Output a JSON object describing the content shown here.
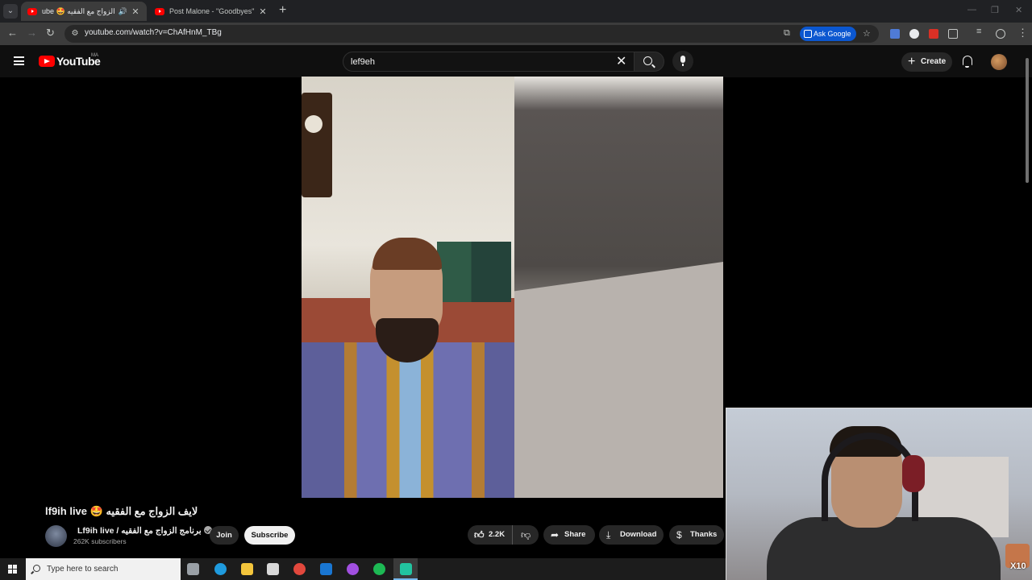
{
  "browser": {
    "tabs": [
      {
        "title": "ube 🤩 لايف الزواج مع الفقيه",
        "active": true
      },
      {
        "title": "Post Malone - \"Goodbyes\" ft. Yo",
        "active": false
      }
    ],
    "url": "youtube.com/watch?v=ChAfHnM_TBg",
    "ask_google": "Ask Google"
  },
  "youtube": {
    "logo_text": "YouTube",
    "country_code": "MA",
    "search_value": "lef9eh",
    "create_label": "Create"
  },
  "video": {
    "title": "lf9ih live 🤩 لايف الزواج مع الفقيه",
    "channel_name": "Lf9ih live / برنامج الزواج مع الفقيه",
    "subscribers": "262K subscribers",
    "join_label": "Join",
    "subscribe_label": "Subscribe",
    "likes": "2.2K",
    "share_label": "Share",
    "download_label": "Download",
    "thanks_label": "Thanks"
  },
  "webcam": {
    "badge": "X10"
  },
  "taskbar": {
    "search_placeholder": "Type here to search",
    "apps": [
      {
        "name": "task-view-icon",
        "color": "#9aa0a6"
      },
      {
        "name": "edge-icon",
        "color": "#1f9bde"
      },
      {
        "name": "file-explorer-icon",
        "color": "#f3c53c"
      },
      {
        "name": "store-icon",
        "color": "#d8d8d8"
      },
      {
        "name": "chrome-icon",
        "color": "#e2483d"
      },
      {
        "name": "outlook-icon",
        "color": "#1976d2"
      },
      {
        "name": "messenger-icon",
        "color": "#a14fe0"
      },
      {
        "name": "spotify-icon",
        "color": "#1db954"
      },
      {
        "name": "app-icon",
        "color": "#22c3a0"
      }
    ]
  }
}
